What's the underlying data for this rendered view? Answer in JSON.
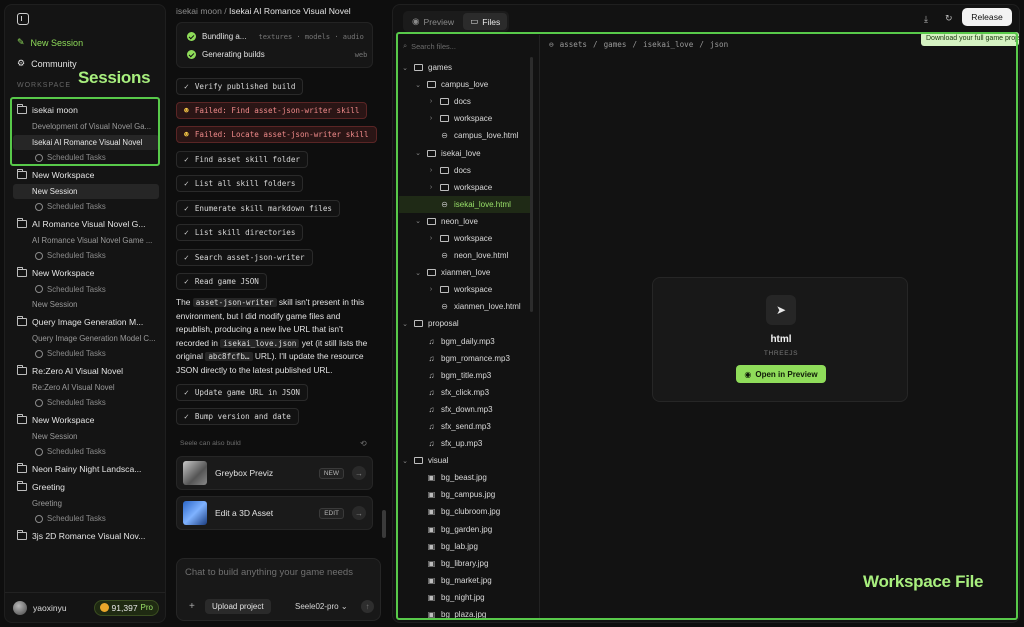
{
  "sidebar": {
    "new_session": "New Session",
    "community": "Community",
    "workspace_label": "WORKSPACE",
    "annotation": "Sessions",
    "items": [
      {
        "type": "ws",
        "label": "isekai moon"
      },
      {
        "type": "sub",
        "label": "Development of Visual Novel Ga..."
      },
      {
        "type": "sub",
        "label": "Isekai AI Romance Visual Novel",
        "selected": true
      },
      {
        "type": "sched",
        "label": "Scheduled Tasks"
      },
      {
        "type": "ws",
        "label": "New Workspace"
      },
      {
        "type": "sub",
        "label": "New Session",
        "selected": true
      },
      {
        "type": "sched",
        "label": "Scheduled Tasks"
      },
      {
        "type": "ws",
        "label": "AI Romance Visual Novel G..."
      },
      {
        "type": "sub",
        "label": "AI Romance Visual Novel Game ..."
      },
      {
        "type": "sched",
        "label": "Scheduled Tasks"
      },
      {
        "type": "ws",
        "label": "New Workspace"
      },
      {
        "type": "sched",
        "label": "Scheduled Tasks"
      },
      {
        "type": "sub",
        "label": "New Session"
      },
      {
        "type": "ws",
        "label": "Query Image Generation M..."
      },
      {
        "type": "sub",
        "label": "Query Image Generation Model C..."
      },
      {
        "type": "sched",
        "label": "Scheduled Tasks"
      },
      {
        "type": "ws",
        "label": "Re:Zero AI Visual Novel"
      },
      {
        "type": "sub",
        "label": "Re:Zero AI Visual Novel"
      },
      {
        "type": "sched",
        "label": "Scheduled Tasks"
      },
      {
        "type": "ws",
        "label": "New Workspace"
      },
      {
        "type": "sub",
        "label": "New Session"
      },
      {
        "type": "sched",
        "label": "Scheduled Tasks"
      },
      {
        "type": "ws",
        "label": "Neon Rainy Night Landsca..."
      },
      {
        "type": "ws",
        "label": "Greeting"
      },
      {
        "type": "sub",
        "label": "Greeting"
      },
      {
        "type": "sched",
        "label": "Scheduled Tasks"
      },
      {
        "type": "ws",
        "label": "3js 2D Romance Visual Nov..."
      }
    ],
    "user": {
      "name": "yaoxinyu",
      "credits": "91,397",
      "plan": "Pro"
    }
  },
  "chat": {
    "breadcrumb_root": "isekai moon",
    "breadcrumb_sep": "/",
    "breadcrumb_current": "Isekai AI Romance Visual Novel",
    "done_steps": [
      {
        "label": "Bundling a...",
        "tags": "textures · models · audio"
      },
      {
        "label": "Generating builds",
        "tags": "web"
      }
    ],
    "steps": [
      {
        "label": "Verify published build",
        "status": "ok"
      },
      {
        "label": "Failed: Find asset-json-writer skill",
        "status": "fail"
      },
      {
        "label": "Failed: Locate asset-json-writer skill",
        "status": "fail"
      },
      {
        "label": "Find asset skill folder",
        "status": "ok"
      },
      {
        "label": "List all skill folders",
        "status": "ok"
      },
      {
        "label": "Enumerate skill markdown files",
        "status": "ok"
      },
      {
        "label": "List skill directories",
        "status": "ok"
      },
      {
        "label": "Search asset-json-writer",
        "status": "ok"
      },
      {
        "label": "Read game JSON",
        "status": "ok"
      }
    ],
    "para": {
      "t1": "The ",
      "c1": "asset-json-writer",
      "t2": " skill isn't present in this environment, but I did modify game files and republish, producing a new live URL that isn't recorded in ",
      "c2": "isekai_love.json",
      "t3": " yet (it still lists the original ",
      "c3": "abc8fcfb…",
      "t4": " URL). I'll update the resource JSON directly to the latest published URL."
    },
    "steps2": [
      {
        "label": "Update game URL in JSON"
      },
      {
        "label": "Bump version and date"
      }
    ],
    "also_label": "Seele can also build",
    "also": [
      {
        "name": "Greybox Previz",
        "tag": "NEW"
      },
      {
        "name": "Edit a 3D Asset",
        "tag": "EDIT"
      }
    ],
    "composer": {
      "placeholder": "Chat to build anything your game needs",
      "upload": "Upload project",
      "model": "Seele02-pro"
    }
  },
  "panel": {
    "tab_preview": "Preview",
    "tab_files": "Files",
    "release": "Release",
    "tooltip": "Download your full game project",
    "search_placeholder": "Search files...",
    "path": [
      "assets",
      "/",
      "games",
      "/",
      "isekai_love",
      "/",
      "json"
    ],
    "tree": [
      {
        "depth": 0,
        "kind": "folder",
        "open": true,
        "label": "games"
      },
      {
        "depth": 1,
        "kind": "folder",
        "open": true,
        "label": "campus_love"
      },
      {
        "depth": 2,
        "kind": "folder",
        "open": false,
        "label": "docs"
      },
      {
        "depth": 2,
        "kind": "folder",
        "open": false,
        "label": "workspace"
      },
      {
        "depth": 2,
        "kind": "html",
        "label": "campus_love.html"
      },
      {
        "depth": 1,
        "kind": "folder",
        "open": true,
        "label": "isekai_love"
      },
      {
        "depth": 2,
        "kind": "folder",
        "open": false,
        "label": "docs"
      },
      {
        "depth": 2,
        "kind": "folder",
        "open": false,
        "label": "workspace"
      },
      {
        "depth": 2,
        "kind": "html",
        "label": "isekai_love.html",
        "selected": true
      },
      {
        "depth": 1,
        "kind": "folder",
        "open": true,
        "label": "neon_love"
      },
      {
        "depth": 2,
        "kind": "folder",
        "open": false,
        "label": "workspace"
      },
      {
        "depth": 2,
        "kind": "html",
        "label": "neon_love.html"
      },
      {
        "depth": 1,
        "kind": "folder",
        "open": true,
        "label": "xianmen_love"
      },
      {
        "depth": 2,
        "kind": "folder",
        "open": false,
        "label": "workspace"
      },
      {
        "depth": 2,
        "kind": "html",
        "label": "xianmen_love.html"
      },
      {
        "depth": 0,
        "kind": "folder",
        "open": true,
        "label": "proposal"
      },
      {
        "depth": 1,
        "kind": "audio",
        "label": "bgm_daily.mp3"
      },
      {
        "depth": 1,
        "kind": "audio",
        "label": "bgm_romance.mp3"
      },
      {
        "depth": 1,
        "kind": "audio",
        "label": "bgm_title.mp3"
      },
      {
        "depth": 1,
        "kind": "audio",
        "label": "sfx_click.mp3"
      },
      {
        "depth": 1,
        "kind": "audio",
        "label": "sfx_down.mp3"
      },
      {
        "depth": 1,
        "kind": "audio",
        "label": "sfx_send.mp3"
      },
      {
        "depth": 1,
        "kind": "audio",
        "label": "sfx_up.mp3"
      },
      {
        "depth": 0,
        "kind": "folder",
        "open": true,
        "label": "visual"
      },
      {
        "depth": 1,
        "kind": "image",
        "label": "bg_beast.jpg"
      },
      {
        "depth": 1,
        "kind": "image",
        "label": "bg_campus.jpg"
      },
      {
        "depth": 1,
        "kind": "image",
        "label": "bg_clubroom.jpg"
      },
      {
        "depth": 1,
        "kind": "image",
        "label": "bg_garden.jpg"
      },
      {
        "depth": 1,
        "kind": "image",
        "label": "bg_lab.jpg"
      },
      {
        "depth": 1,
        "kind": "image",
        "label": "bg_library.jpg"
      },
      {
        "depth": 1,
        "kind": "image",
        "label": "bg_market.jpg"
      },
      {
        "depth": 1,
        "kind": "image",
        "label": "bg_night.jpg"
      },
      {
        "depth": 1,
        "kind": "image",
        "label": "bg_plaza.jpg"
      }
    ],
    "preview": {
      "title": "html",
      "subtitle": "THREEJS",
      "button": "Open in Preview"
    },
    "annotation": "Workspace File"
  },
  "colors": {
    "accent": "#8fdc5a",
    "annotation": "#58c94a",
    "fail": "#ef8a8a"
  }
}
